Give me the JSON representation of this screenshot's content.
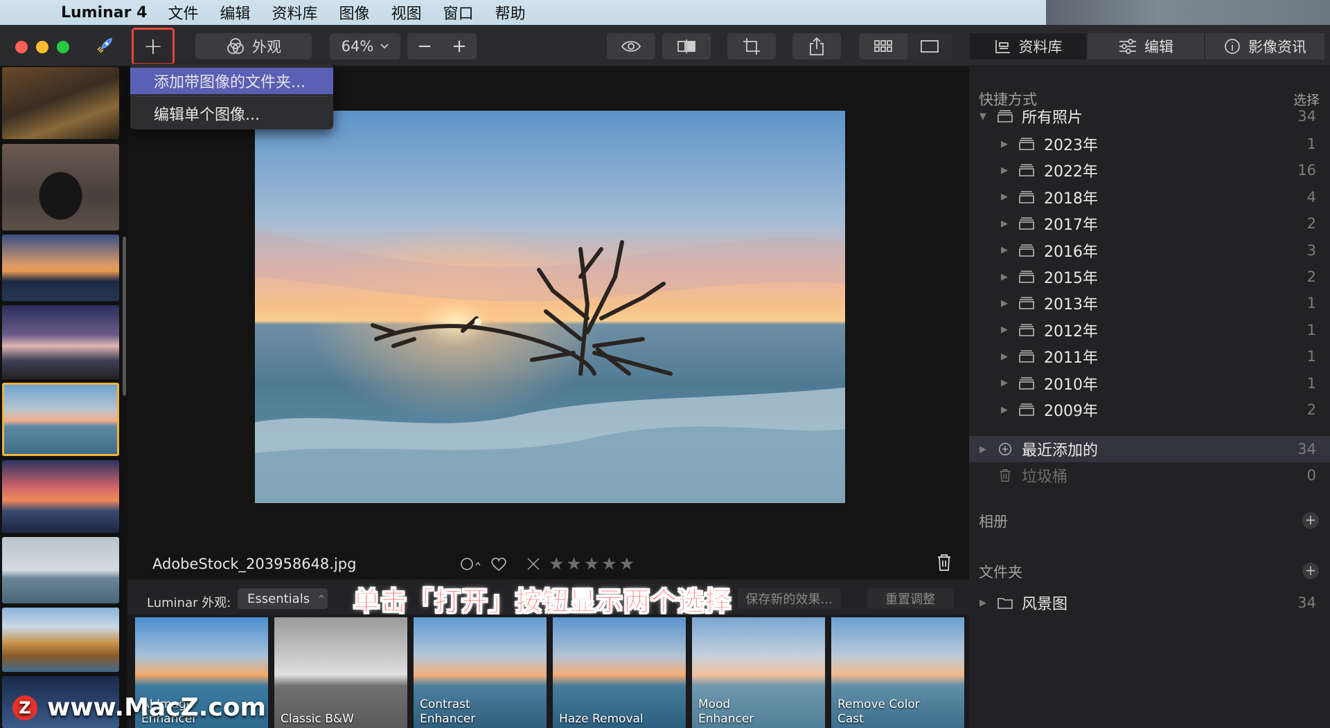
{
  "menubar": {
    "app": "Luminar 4",
    "items": [
      "文件",
      "编辑",
      "资料库",
      "图像",
      "视图",
      "窗口",
      "帮助"
    ]
  },
  "toolbar": {
    "add": "+",
    "looks": "外观",
    "zoom": "64%",
    "zoom_minus": "−",
    "zoom_plus": "+",
    "tabs": {
      "library": "资料库",
      "edit": "编辑",
      "info": "影像资讯"
    }
  },
  "dropdown": {
    "items": [
      "添加带图像的文件夹...",
      "编辑单个图像..."
    ]
  },
  "viewer": {
    "filename": "AdobeStock_203958648.jpg"
  },
  "looks": {
    "label": "Luminar 外观:",
    "collection": "Essentials",
    "save": "保存新的效果...",
    "reset": "重置调整",
    "caption": "单击「打开」按钮显示两个选择",
    "presets": [
      "AI Image\nEnhancer",
      "Classic B&W",
      "Contrast\nEnhancer",
      "Haze Removal",
      "Mood\nEnhancer",
      "Remove Color\nCast"
    ]
  },
  "panel": {
    "shortcuts": "快捷方式",
    "select": "选择",
    "all_photos": {
      "label": "所有照片",
      "count": "34"
    },
    "years": [
      {
        "label": "2023年",
        "count": "1"
      },
      {
        "label": "2022年",
        "count": "16"
      },
      {
        "label": "2018年",
        "count": "4"
      },
      {
        "label": "2017年",
        "count": "2"
      },
      {
        "label": "2016年",
        "count": "3"
      },
      {
        "label": "2015年",
        "count": "2"
      },
      {
        "label": "2013年",
        "count": "1"
      },
      {
        "label": "2012年",
        "count": "1"
      },
      {
        "label": "2011年",
        "count": "1"
      },
      {
        "label": "2010年",
        "count": "1"
      },
      {
        "label": "2009年",
        "count": "2"
      }
    ],
    "recent": {
      "label": "最近添加的",
      "count": "34"
    },
    "trash": {
      "label": "垃圾桶",
      "count": "0"
    },
    "albums": "相册",
    "folders": "文件夹",
    "folder_items": [
      {
        "label": "风景图",
        "count": "34"
      }
    ]
  },
  "watermark": {
    "logo": "Z",
    "text": "www.MacZ.com"
  }
}
